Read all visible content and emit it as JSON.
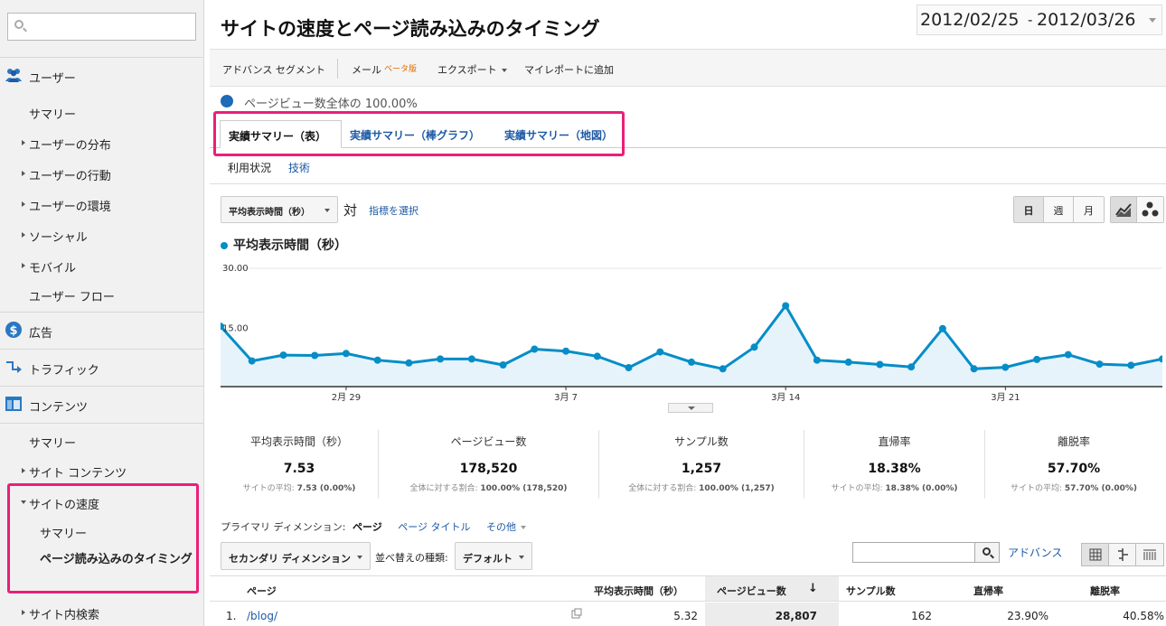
{
  "sidebar": {
    "search_placeholder": "",
    "sections": {
      "users": {
        "label": "ユーザー",
        "items": {
          "summary": "サマリー",
          "distribution": "ユーザーの分布",
          "behavior": "ユーザーの行動",
          "environment": "ユーザーの環境",
          "social": "ソーシャル",
          "mobile": "モバイル",
          "flow": "ユーザー フロー"
        }
      },
      "ads": {
        "label": "広告"
      },
      "traffic": {
        "label": "トラフィック"
      },
      "content": {
        "label": "コンテンツ",
        "items": {
          "summary": "サマリー",
          "site_content": "サイト コンテンツ",
          "site_speed": "サイトの速度",
          "speed_summary": "サマリー",
          "page_timing": "ページ読み込みのタイミング",
          "site_search": "サイト内検索"
        }
      }
    }
  },
  "header": {
    "title": "サイトの速度とページ読み込みのタイミング",
    "date_start": "2012/02/25",
    "date_sep": "-",
    "date_end": "2012/03/26"
  },
  "toolbar": {
    "advanced_segment": "アドバンス セグメント",
    "mail": "メール",
    "beta": "ベータ版",
    "export": "エクスポート",
    "add_to_myreport": "マイレポートに追加"
  },
  "segment": {
    "text": "ページビュー数全体の 100.00%"
  },
  "tabs": {
    "table": "実績サマリー（表）",
    "bar": "実績サマリー（棒グラフ）",
    "map": "実績サマリー（地図）"
  },
  "subtabs": {
    "usage": "利用状況",
    "tech": "技術"
  },
  "controls": {
    "metric": "平均表示時間（秒）",
    "vs": "対",
    "pick_metric": "指標を選択",
    "day": "日",
    "week": "週",
    "month": "月"
  },
  "chart_data": {
    "type": "line",
    "series": [
      {
        "name": "平均表示時間（秒）",
        "values": [
          15.3,
          6.5,
          8.0,
          7.9,
          8.4,
          6.7,
          6.0,
          7.0,
          7.0,
          5.5,
          9.5,
          9.0,
          7.7,
          4.8,
          8.8,
          6.2,
          4.5,
          10.0,
          20.5,
          6.7,
          6.2,
          5.6,
          5.0,
          14.7,
          4.5,
          4.9,
          6.9,
          8.1,
          5.7,
          5.4,
          7.0
        ]
      }
    ],
    "x": [
      "2/25",
      "2/26",
      "2/27",
      "2/28",
      "2/29",
      "3/1",
      "3/2",
      "3/3",
      "3/4",
      "3/5",
      "3/6",
      "3/7",
      "3/8",
      "3/9",
      "3/10",
      "3/11",
      "3/12",
      "3/13",
      "3/14",
      "3/15",
      "3/16",
      "3/17",
      "3/18",
      "3/19",
      "3/20",
      "3/21",
      "3/22",
      "3/23",
      "3/24",
      "3/25",
      "3/26"
    ],
    "x_tick_labels": [
      {
        "index": 4,
        "label": "2月 29"
      },
      {
        "index": 11,
        "label": "3月 7"
      },
      {
        "index": 18,
        "label": "3月 14"
      },
      {
        "index": 25,
        "label": "3月 21"
      }
    ],
    "y_tick_labels": [
      "30.00",
      "15.00"
    ],
    "ylim": [
      0,
      30
    ],
    "grid": false,
    "colors": {
      "line": "#058dc7",
      "fill": "#e6f3fa"
    }
  },
  "summary": [
    {
      "label": "平均表示時間（秒）",
      "value": "7.53",
      "sub_prefix": "サイトの平均:",
      "sub_value": "7.53 (0.00%)"
    },
    {
      "label": "ページビュー数",
      "value": "178,520",
      "sub_prefix": "全体に対する割合:",
      "sub_value": "100.00% (178,520)"
    },
    {
      "label": "サンプル数",
      "value": "1,257",
      "sub_prefix": "全体に対する割合:",
      "sub_value": "100.00% (1,257)"
    },
    {
      "label": "直帰率",
      "value": "18.38%",
      "sub_prefix": "サイトの平均:",
      "sub_value": "18.38% (0.00%)"
    },
    {
      "label": "離脱率",
      "value": "57.70%",
      "sub_prefix": "サイトの平均:",
      "sub_value": "57.70% (0.00%)"
    }
  ],
  "primary_dimension": {
    "label": "プライマリ ディメンション:",
    "current": "ページ",
    "page_title": "ページ タイトル",
    "other": "その他"
  },
  "table_controls": {
    "secondary": "セカンダリ ディメンション",
    "sort_label": "並べ替えの種類:",
    "sort_value": "デフォルト",
    "advanced": "アドバンス"
  },
  "table": {
    "headers": {
      "page": "ページ",
      "avg_time": "平均表示時間（秒）",
      "pageviews": "ページビュー数",
      "samples": "サンプル数",
      "bounce": "直帰率",
      "exit": "離脱率"
    },
    "rows": [
      {
        "index": "1.",
        "page": "/blog/",
        "avg_time": "5.32",
        "pageviews": "28,807",
        "samples": "162",
        "bounce": "23.90%",
        "exit": "40.58%"
      }
    ]
  },
  "colors": {
    "accent": "#1d5aa6",
    "highlight": "#ec1e79"
  }
}
